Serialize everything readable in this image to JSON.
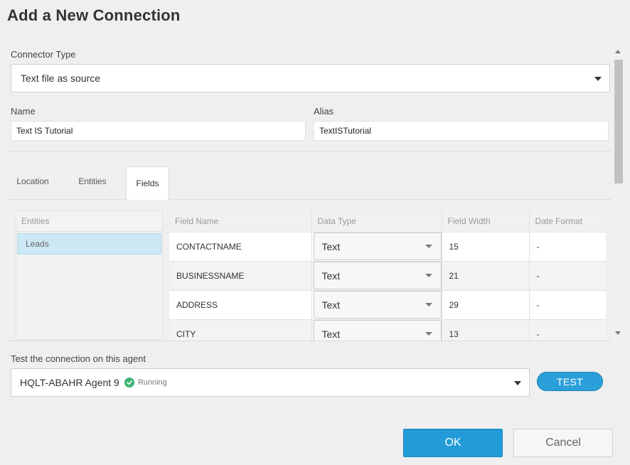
{
  "dialog": {
    "title": "Add a New Connection"
  },
  "connector": {
    "label": "Connector Type",
    "value": "Text file as source"
  },
  "name_field": {
    "label": "Name",
    "value": "Text IS Tutorial"
  },
  "alias_field": {
    "label": "Alias",
    "value": "TextISTutorial"
  },
  "tabs": [
    {
      "label": "Location"
    },
    {
      "label": "Entities"
    },
    {
      "label": "Fields"
    }
  ],
  "active_tab": "Fields",
  "entities": {
    "header": "Entities",
    "items": [
      "Leads"
    ]
  },
  "fields_grid": {
    "columns": [
      "Field Name",
      "Data Type",
      "Field Width",
      "Date Format"
    ],
    "rows": [
      {
        "field_name": "CONTACTNAME",
        "data_type": "Text",
        "field_width": "15",
        "date_format": "-"
      },
      {
        "field_name": "BUSINESSNAME",
        "data_type": "Text",
        "field_width": "21",
        "date_format": "-"
      },
      {
        "field_name": "ADDRESS",
        "data_type": "Text",
        "field_width": "29",
        "date_format": "-"
      },
      {
        "field_name": "CITY",
        "data_type": "Text",
        "field_width": "13",
        "date_format": "-"
      }
    ]
  },
  "agent": {
    "label": "Test the connection on this agent",
    "name": "HQLT-ABAHR Agent 9",
    "status": "Running"
  },
  "buttons": {
    "test": "TEST",
    "ok": "OK",
    "cancel": "Cancel"
  },
  "colors": {
    "accent": "#229bd8",
    "status_ok": "#3cb371",
    "selected_row": "#cce8f5"
  },
  "icons": {
    "dropdown": "caret-down-icon",
    "status": "check-circle-icon"
  }
}
